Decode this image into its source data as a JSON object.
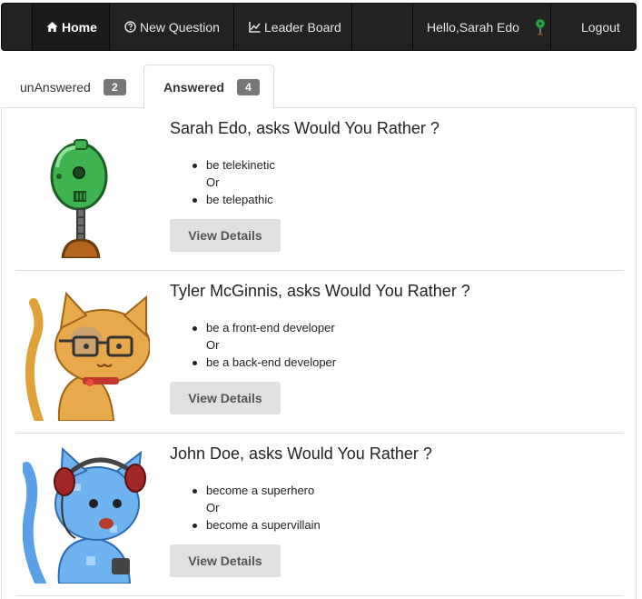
{
  "navbar": {
    "home_label": "Home",
    "new_question_label": "New Question",
    "leader_board_label": "Leader Board",
    "greeting": "Hello,Sarah Edo",
    "logout_label": "Logout"
  },
  "tabs": {
    "unanswered": {
      "label": "unAnswered",
      "count": "2"
    },
    "answered": {
      "label": "Answered",
      "count": "4"
    }
  },
  "questions": [
    {
      "title": "Sarah Edo, asks Would You Rather ?",
      "option_one": "be telekinetic",
      "or": "Or",
      "option_two": "be telepathic",
      "button": "View Details",
      "avatar": "green-robot-avatar"
    },
    {
      "title": "Tyler McGinnis, asks Would You Rather ?",
      "option_one": "be a front-end developer",
      "or": "Or",
      "option_two": "be a back-end developer",
      "button": "View Details",
      "avatar": "orange-cat-glasses-avatar"
    },
    {
      "title": "John Doe, asks Would You Rather ?",
      "option_one": "become a superhero",
      "or": "Or",
      "option_two": "become a supervillain",
      "button": "View Details",
      "avatar": "blue-cat-headphones-avatar"
    }
  ],
  "colors": {
    "navbar_bg": "#222222",
    "badge_bg": "#777777",
    "button_bg": "#e0e0e0"
  }
}
